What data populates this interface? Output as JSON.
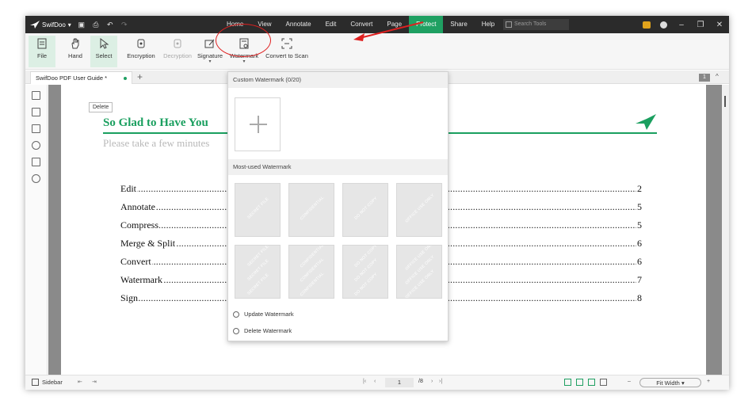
{
  "app": {
    "name": "SwifDoo",
    "menu": [
      "Home",
      "View",
      "Annotate",
      "Edit",
      "Convert",
      "Page",
      "Protect",
      "Share",
      "Help"
    ],
    "active_menu": "Protect",
    "search_placeholder": "Search Tools"
  },
  "ribbon": {
    "file": "File",
    "hand": "Hand",
    "select": "Select",
    "encryption": "Encryption",
    "decryption": "Decryption",
    "signature": "Signature",
    "watermark": "Watermark",
    "convert_to_scan": "Convert to Scan"
  },
  "tabs": {
    "doc_tab": "SwifDoo PDF User Guide *",
    "page_badge": "1"
  },
  "document": {
    "tooltip": "Delete",
    "title": "So Glad to Have You",
    "subtitle": "Please take a few minutes",
    "toc": [
      {
        "label": "Edit",
        "page": "2"
      },
      {
        "label": "Annotate",
        "page": "5"
      },
      {
        "label": "Compress",
        "page": "5"
      },
      {
        "label": "Merge & Split",
        "page": "6"
      },
      {
        "label": "Convert",
        "page": "6"
      },
      {
        "label": "Watermark",
        "page": "7"
      },
      {
        "label": "Sign",
        "page": "8"
      }
    ]
  },
  "watermark_panel": {
    "custom_header": "Custom Watermark (0/20)",
    "most_used_header": "Most-used Watermark",
    "presets": [
      "SECRET FILE",
      "CONFIDENTIAL",
      "DO NOT COPY",
      "OFFICE USE ONLY"
    ],
    "update": "Update Watermark",
    "delete": "Delete Watermark"
  },
  "status": {
    "sidebar": "Sidebar",
    "current_page": "1",
    "total_pages": "/8",
    "zoom": "Fit Width"
  },
  "colors": {
    "accent": "#1fa062",
    "annotation": "#e02020",
    "titlebar": "#2b2b2b"
  }
}
